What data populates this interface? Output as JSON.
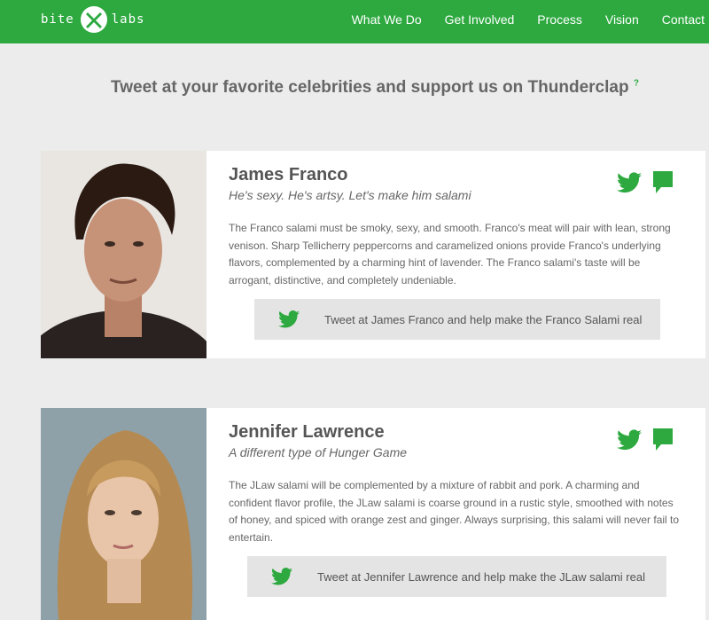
{
  "header": {
    "logo": {
      "left": "bite",
      "right": "labs"
    },
    "nav": [
      "What We Do",
      "Get Involved",
      "Process",
      "Vision",
      "Contact"
    ]
  },
  "headline": {
    "text": "Tweet at your favorite celebrities and support us on Thunderclap",
    "help": "?"
  },
  "celebrities": [
    {
      "name": "James Franco",
      "tagline": "He's sexy. He's artsy. Let's make him salami",
      "description": "The Franco salami must be smoky, sexy, and smooth. Franco's meat will pair with lean, strong venison. Sharp Tellicherry peppercorns and caramelized onions provide Franco's underlying flavors, complemented by a charming hint of lavender. The Franco salami's taste will be arrogant, distinctive, and completely undeniable.",
      "tweet_label": "Tweet at James Franco and help make the Franco Salami real"
    },
    {
      "name": "Jennifer Lawrence",
      "tagline": "A different type of Hunger Game",
      "description": "The JLaw salami will be complemented by a mixture of rabbit and pork. A charming and confident flavor profile, the JLaw salami is coarse ground in a rustic style, smoothed with notes of honey, and spiced with orange zest and ginger. Always surprising, this salami will never fail to entertain.",
      "tweet_label": "Tweet at Jennifer Lawrence and help make the JLaw salami real"
    }
  ],
  "colors": {
    "brand": "#2ea940",
    "background": "#ececec",
    "button": "#e4e4e4"
  },
  "icons": [
    "logo-x-icon",
    "twitter-bird-icon",
    "comment-bubble-icon"
  ]
}
